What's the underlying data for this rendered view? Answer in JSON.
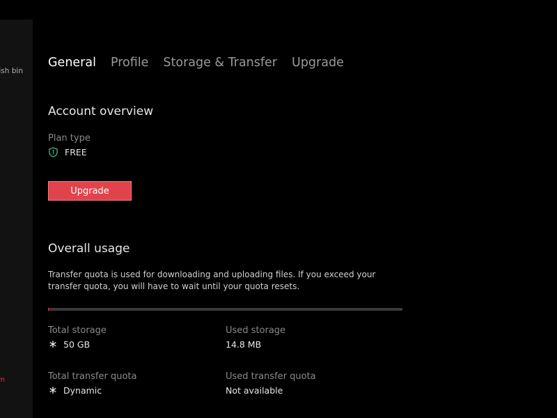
{
  "sidebar": {
    "rubbish_bin_label": "bish bin",
    "red_label": "m"
  },
  "tabs": [
    {
      "label": "General",
      "active": true
    },
    {
      "label": "Profile",
      "active": false
    },
    {
      "label": "Storage & Transfer",
      "active": false
    },
    {
      "label": "Upgrade",
      "active": false
    }
  ],
  "account": {
    "title": "Account overview",
    "plan_label": "Plan type",
    "plan_value": "FREE",
    "upgrade_button": "Upgrade"
  },
  "usage": {
    "title": "Overall usage",
    "description": "Transfer quota is used for downloading and uploading files. If you exceed your transfer quota, you will have to wait until your quota resets.",
    "used_fraction": 0.0003,
    "total_storage_label": "Total storage",
    "total_storage_value": "50 GB",
    "used_storage_label": "Used storage",
    "used_storage_value": "14.8 MB",
    "total_transfer_label": "Total transfer quota",
    "total_transfer_value": "Dynamic",
    "used_transfer_label": "Used transfer quota",
    "used_transfer_value": "Not available"
  },
  "colors": {
    "accent": "#e0434b",
    "shield": "#3fb98d",
    "background": "#000000"
  },
  "icons": {
    "plan": "shield-icon",
    "storage": "asterisk-icon",
    "transfer": "asterisk-icon"
  }
}
